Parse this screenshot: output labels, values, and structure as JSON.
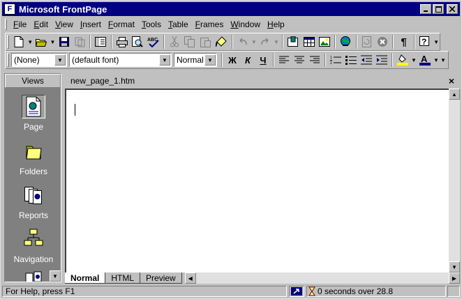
{
  "window": {
    "title": "Microsoft FrontPage"
  },
  "menu": {
    "items": [
      {
        "label": "File",
        "key": "F",
        "rest": "ile"
      },
      {
        "label": "Edit",
        "key": "E",
        "rest": "dit"
      },
      {
        "label": "View",
        "key": "V",
        "rest": "iew"
      },
      {
        "label": "Insert",
        "key": "I",
        "rest": "nsert"
      },
      {
        "label": "Format",
        "key": "F",
        "rest": "ormat"
      },
      {
        "label": "Tools",
        "key": "T",
        "rest": "ools"
      },
      {
        "label": "Table",
        "key": "T",
        "rest": "able"
      },
      {
        "label": "Frames",
        "key": "F",
        "rest": "rames"
      },
      {
        "label": "Window",
        "key": "W",
        "rest": "indow"
      },
      {
        "label": "Help",
        "key": "H",
        "rest": "elp"
      }
    ]
  },
  "format": {
    "style": "(None)",
    "font": "(default font)",
    "size": "Normal",
    "bold": "Ж",
    "italic": "К",
    "underline": "Ч"
  },
  "views": {
    "header": "Views",
    "items": [
      {
        "label": "Page"
      },
      {
        "label": "Folders"
      },
      {
        "label": "Reports"
      },
      {
        "label": "Navigation"
      }
    ]
  },
  "document": {
    "tab_title": "new_page_1.htm",
    "close": "×"
  },
  "view_tabs": [
    "Normal",
    "HTML",
    "Preview"
  ],
  "status": {
    "help": "For Help, press F1",
    "timing": "0 seconds over 28.8"
  },
  "colors": {
    "titlebar": "#000080",
    "face": "#c0c0c0",
    "views_bg": "#808080"
  }
}
